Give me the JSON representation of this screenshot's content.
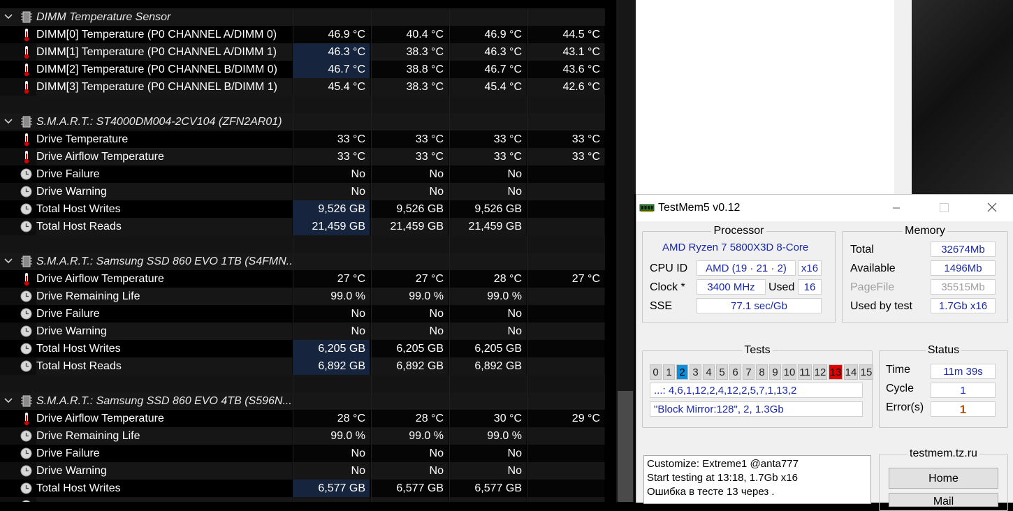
{
  "hwinfo": {
    "rows": [
      {
        "kind": "group",
        "label": "DIMM Temperature Sensor",
        "values": [
          "",
          "",
          "",
          ""
        ]
      },
      {
        "kind": "temp",
        "label": "DIMM[0] Temperature (P0 CHANNEL A/DIMM 0)",
        "values": [
          "46.9 °C",
          "40.4 °C",
          "46.9 °C",
          "44.5 °C"
        ]
      },
      {
        "kind": "temp",
        "label": "DIMM[1] Temperature (P0 CHANNEL A/DIMM 1)",
        "values": [
          "46.3 °C",
          "38.3 °C",
          "46.3 °C",
          "43.1 °C"
        ]
      },
      {
        "kind": "temp",
        "label": "DIMM[2] Temperature (P0 CHANNEL B/DIMM 0)",
        "values": [
          "46.7 °C",
          "38.8 °C",
          "46.7 °C",
          "43.6 °C"
        ]
      },
      {
        "kind": "temp",
        "label": "DIMM[3] Temperature (P0 CHANNEL B/DIMM 1)",
        "values": [
          "45.4 °C",
          "38.3 °C",
          "45.4 °C",
          "42.6 °C"
        ]
      },
      {
        "kind": "blank",
        "label": "",
        "values": [
          "",
          "",
          "",
          ""
        ]
      },
      {
        "kind": "group",
        "label": "S.M.A.R.T.: ST4000DM004-2CV104 (ZFN2AR01)",
        "values": [
          "",
          "",
          "",
          ""
        ]
      },
      {
        "kind": "temp",
        "label": "Drive Temperature",
        "values": [
          "33 °C",
          "33 °C",
          "33 °C",
          "33 °C"
        ]
      },
      {
        "kind": "temp",
        "label": "Drive Airflow Temperature",
        "values": [
          "33 °C",
          "33 °C",
          "33 °C",
          "33 °C"
        ]
      },
      {
        "kind": "clock",
        "label": "Drive Failure",
        "values": [
          "No",
          "No",
          "No",
          ""
        ]
      },
      {
        "kind": "clock",
        "label": "Drive Warning",
        "values": [
          "No",
          "No",
          "No",
          ""
        ]
      },
      {
        "kind": "clock",
        "label": "Total Host Writes",
        "values": [
          "9,526 GB",
          "9,526 GB",
          "9,526 GB",
          ""
        ]
      },
      {
        "kind": "clock",
        "label": "Total Host Reads",
        "values": [
          "21,459 GB",
          "21,459 GB",
          "21,459 GB",
          ""
        ]
      },
      {
        "kind": "blank",
        "label": "",
        "values": [
          "",
          "",
          "",
          ""
        ]
      },
      {
        "kind": "group",
        "label": "S.M.A.R.T.: Samsung SSD 860 EVO 1TB (S4FMN...",
        "values": [
          "",
          "",
          "",
          ""
        ]
      },
      {
        "kind": "temp",
        "label": "Drive Airflow Temperature",
        "values": [
          "27 °C",
          "27 °C",
          "28 °C",
          "27 °C"
        ]
      },
      {
        "kind": "clock",
        "label": "Drive Remaining Life",
        "values": [
          "99.0 %",
          "99.0 %",
          "99.0 %",
          ""
        ]
      },
      {
        "kind": "clock",
        "label": "Drive Failure",
        "values": [
          "No",
          "No",
          "No",
          ""
        ]
      },
      {
        "kind": "clock",
        "label": "Drive Warning",
        "values": [
          "No",
          "No",
          "No",
          ""
        ]
      },
      {
        "kind": "clock",
        "label": "Total Host Writes",
        "values": [
          "6,205 GB",
          "6,205 GB",
          "6,205 GB",
          ""
        ]
      },
      {
        "kind": "clock",
        "label": "Total Host Reads",
        "values": [
          "6,892 GB",
          "6,892 GB",
          "6,892 GB",
          ""
        ]
      },
      {
        "kind": "blank",
        "label": "",
        "values": [
          "",
          "",
          "",
          ""
        ]
      },
      {
        "kind": "group",
        "label": "S.M.A.R.T.: Samsung SSD 860 EVO 4TB (S596N...",
        "values": [
          "",
          "",
          "",
          ""
        ]
      },
      {
        "kind": "temp",
        "label": "Drive Airflow Temperature",
        "values": [
          "28 °C",
          "28 °C",
          "30 °C",
          "29 °C"
        ]
      },
      {
        "kind": "clock",
        "label": "Drive Remaining Life",
        "values": [
          "99.0 %",
          "99.0 %",
          "99.0 %",
          ""
        ]
      },
      {
        "kind": "clock",
        "label": "Drive Failure",
        "values": [
          "No",
          "No",
          "No",
          ""
        ]
      },
      {
        "kind": "clock",
        "label": "Drive Warning",
        "values": [
          "No",
          "No",
          "No",
          ""
        ]
      },
      {
        "kind": "clock",
        "label": "Total Host Writes",
        "values": [
          "6,577 GB",
          "6,577 GB",
          "6,577 GB",
          ""
        ]
      },
      {
        "kind": "clock",
        "label": "",
        "values": [
          "",
          "",
          "",
          ""
        ]
      }
    ]
  },
  "testmem": {
    "title": "TestMem5 v0.12",
    "processor": {
      "heading": "Processor",
      "name": "AMD Ryzen 7 5800X3D 8-Core",
      "cpuid_label": "CPU ID",
      "cpuid_value": "AMD  (19 · 21 · 2)",
      "cpuid_mult": "x16",
      "clock_label": "Clock *",
      "clock_value": "3400 MHz",
      "used_label": "Used",
      "used_value": "16",
      "sse_label": "SSE",
      "sse_value": "77.1 sec/Gb"
    },
    "memory": {
      "heading": "Memory",
      "total_label": "Total",
      "total_value": "32674Mb",
      "available_label": "Available",
      "available_value": "1496Mb",
      "pagefile_label": "PageFile",
      "pagefile_value": "35515Mb",
      "usedbytest_label": "Used by test",
      "usedbytest_value": "1.7Gb x16"
    },
    "tests": {
      "heading": "Tests",
      "numbers": [
        "0",
        "1",
        "2",
        "3",
        "4",
        "5",
        "6",
        "7",
        "8",
        "9",
        "10",
        "11",
        "12",
        "13",
        "14",
        "15"
      ],
      "current_index": 2,
      "error_index": 13,
      "sequence": "...: 4,6,1,12,2,4,12,2,5,7,1,13,2",
      "current_test": "\"Block Mirror:128\", 2, 1.3Gb"
    },
    "status": {
      "heading": "Status",
      "time_label": "Time",
      "time_value": "11m 39s",
      "cycle_label": "Cycle",
      "cycle_value": "1",
      "errors_label": "Error(s)",
      "errors_value": "1"
    },
    "log": [
      "Customize: Extreme1 @anta777",
      "Start testing at 13:18, 1.7Gb x16",
      "Ошибка в тесте 13 через ."
    ],
    "site": {
      "heading": "testmem.tz.ru",
      "home_label": "Home",
      "mail_label": "Mail"
    }
  }
}
